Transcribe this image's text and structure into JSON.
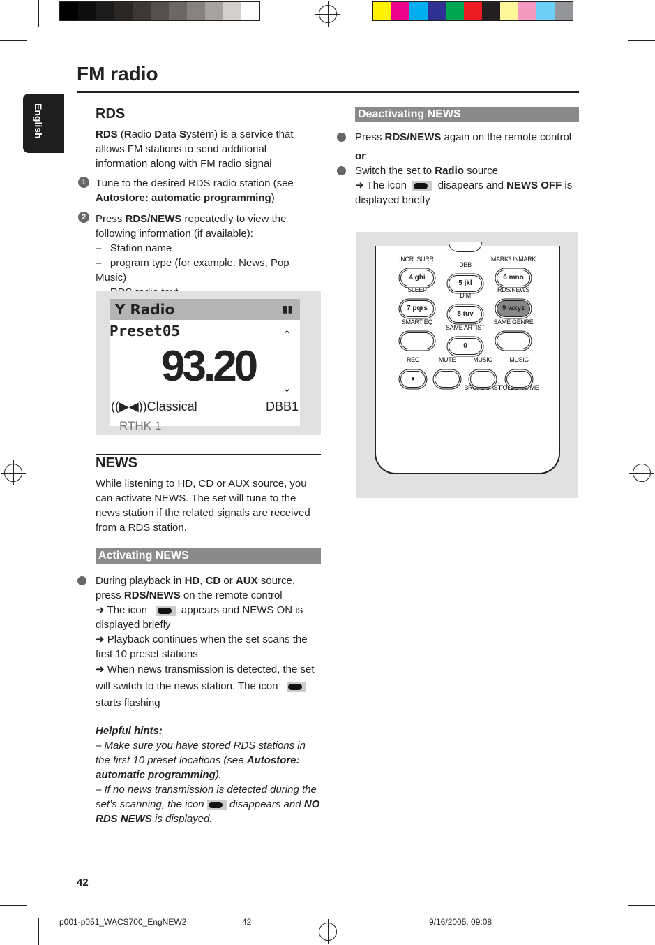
{
  "colors": {
    "gray_bars": [
      "#000000",
      "#0e0e0e",
      "#1b1b1b",
      "#2a2725",
      "#3d3836",
      "#55504d",
      "#6c6764",
      "#87827f",
      "#a7a3a0",
      "#d2cfcc",
      "#ffffff"
    ],
    "color_bars": [
      "#fff200",
      "#ec008c",
      "#00aeef",
      "#2e3192",
      "#00a651",
      "#ed1c24",
      "#231f20",
      "#fff799",
      "#f49ac1",
      "#6dcff6",
      "#939598"
    ],
    "section_bar": "#8a8a8a",
    "tab": "#1e1e1e"
  },
  "title": "FM radio",
  "language_tab": "English",
  "rds": {
    "heading": "RDS",
    "intro": [
      {
        "b": "RDS"
      },
      {
        "t": " ("
      },
      {
        "b": "R"
      },
      {
        "t": "adio "
      },
      {
        "b": "D"
      },
      {
        "t": "ata "
      },
      {
        "b": "S"
      },
      {
        "t": "ystem) is a service that allows FM stations to send additional information along with FM radio signal"
      }
    ],
    "step1": {
      "num": "1",
      "text": "Tune to the desired RDS radio station (see ",
      "bold": "Autostore: automatic programming",
      "end": ")"
    },
    "step2": {
      "num": "2",
      "pre": "Press ",
      "bold": "RDS/NEWS",
      "post": " repeatedly to view the following information (if available):"
    },
    "list": [
      "Station name",
      "program type (for example: News, Pop Music)",
      "RDS radio text"
    ]
  },
  "display": {
    "source": "Radio",
    "preset": "Preset05",
    "frequency": "93.20",
    "genre": "((▶◀))Classical",
    "dbb": "DBB1",
    "station": "RTHK 1"
  },
  "news": {
    "heading": "NEWS",
    "text": "While listening to HD, CD or AUX source, you can activate NEWS. The set will tune to the news station if the related signals are received from a RDS station."
  },
  "activating": {
    "heading": "Activating NEWS",
    "p1": {
      "a": "During playback in ",
      "b1": "HD",
      ", ": "",
      "b2": "CD",
      "c": " or ",
      "b3": "AUX",
      "d": " source, press ",
      "b4": "RDS/NEWS",
      "e": " on the remote control"
    },
    "r1a": "➜ The icon",
    "r1b": "appears and NEWS ON is displayed briefly",
    "r2": "➜ Playback continues when the set scans the first 10 preset stations",
    "r3a": "➜ When news transmission is detected, the set will switch to the news station. The icon",
    "r3b": "starts flashing"
  },
  "hints": {
    "heading": "Helpful hints:",
    "h1a": "–  Make sure you have stored RDS stations in the first 10 preset locations (see ",
    "h1b": "Autostore: automatic programming",
    "h1c": ").",
    "h2a": "–  If no news transmission is detected during the set’s scanning,  the icon",
    "h2b": "disappears and ",
    "h2c": "NO RDS NEWS",
    "h2d": " is displayed."
  },
  "deactivating": {
    "heading": "Deactivating NEWS",
    "b1a": "Press ",
    "b1b": "RDS/NEWS",
    "b1c": " again on the remote control",
    "or": "or",
    "b2a": "Switch the set to ",
    "b2b": "Radio",
    "b2c": " source",
    "r1a": "➜ The icon",
    "r1b": "disapears and ",
    "r1c": "NEWS OFF",
    "r1d": " is displayed briefly"
  },
  "remote": {
    "labels": [
      "INCR. SURR.",
      "DBB",
      "MARK/UNMARK",
      "SLEEP",
      "DIM",
      "RDS/NEWS",
      "SMART EQ",
      "SAME ARTIST",
      "SAME GENRE",
      "REC",
      "MUTE",
      "MUSIC",
      "MUSIC",
      "BROADCAST",
      "FOLLOWS ME"
    ],
    "keys": [
      "4  ghi",
      "5  jkl",
      "6  mno",
      "7  pqrs",
      "8  tuv",
      "9  wxyz",
      "0",
      "●"
    ]
  },
  "page_number": "42",
  "footer": {
    "file": "p001-p051_WACS700_EngNEW2",
    "page": "42",
    "date": "9/16/2005, 09:08"
  }
}
